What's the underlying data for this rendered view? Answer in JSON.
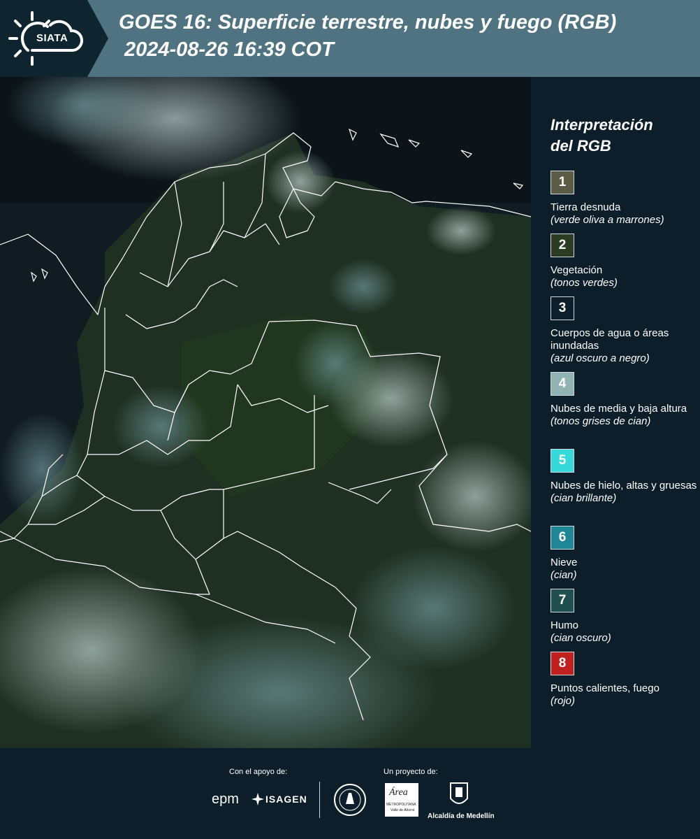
{
  "header": {
    "logo_text": "SIATA",
    "title_line1": "GOES 16: Superficie terrestre, nubes y fuego (RGB)",
    "title_line2": "2024-08-26 16:39 COT"
  },
  "legend": {
    "title_line1": "Interpretación",
    "title_line2": "del RGB",
    "items": [
      {
        "num": "1",
        "color": "#5c5b45",
        "label": "Tierra desnuda",
        "sub": "(verde oliva a marrones)"
      },
      {
        "num": "2",
        "color": "#2b3c22",
        "label": "Vegetación",
        "sub": "(tonos verdes)"
      },
      {
        "num": "3",
        "color": "#0b1e29",
        "label": "Cuerpos de agua o áreas inundadas",
        "sub": "(azul oscuro a negro)"
      },
      {
        "num": "4",
        "color": "#8fb4b1",
        "label": "Nubes de media y baja altura",
        "sub": "(tonos grises de cian)"
      },
      {
        "num": "5",
        "color": "#35d9d9",
        "label": "Nubes de hielo, altas y gruesas",
        "sub": "(cian brillante)"
      },
      {
        "num": "6",
        "color": "#1f8696",
        "label": "Nieve",
        "sub": "(cian)"
      },
      {
        "num": "7",
        "color": "#1f504f",
        "label": "Humo",
        "sub": "(cian oscuro)"
      },
      {
        "num": "8",
        "color": "#c0201e",
        "label": "Puntos calientes, fuego",
        "sub": "(rojo)"
      }
    ]
  },
  "footer": {
    "support_label": "Con el apoyo de:",
    "project_label": "Un proyecto de:",
    "logo_epm": "epm",
    "logo_isagen": "ISAGEN",
    "logo_area_line1": "Área",
    "logo_area_line2": "METROPOLITANA",
    "logo_area_line3": "Valle de Aburrá",
    "logo_alcaldia": "Alcaldía de Medellín"
  }
}
